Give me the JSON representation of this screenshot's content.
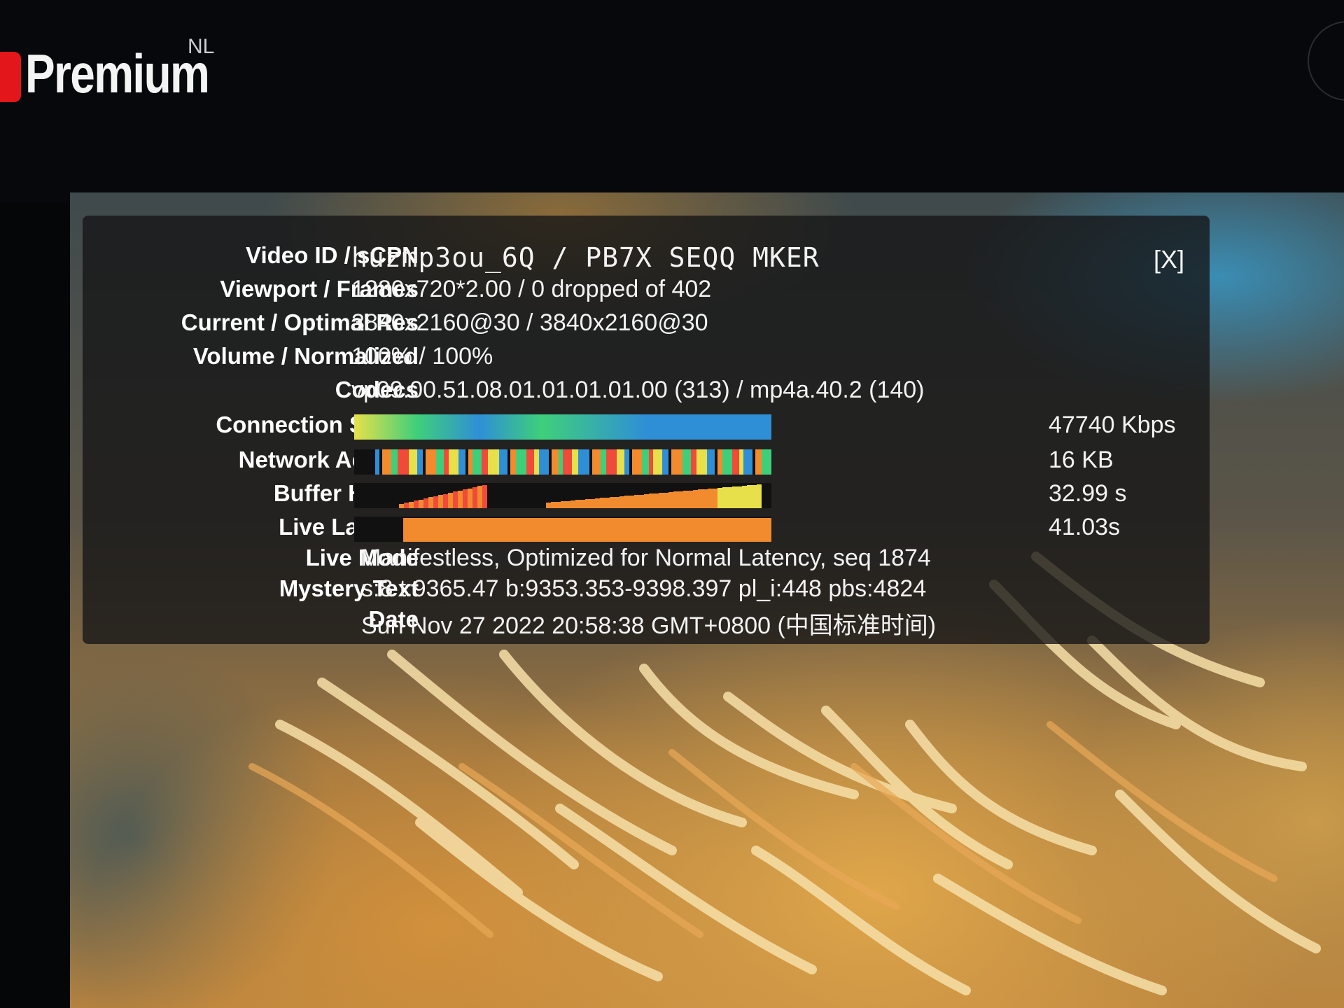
{
  "brand": {
    "word": "Premium",
    "region": "NL"
  },
  "stats": {
    "close_label": "[X]",
    "rows": [
      {
        "label": "Video ID / sCPN",
        "value": "huzmp3ou_6Q / PB7X SEQQ MKER"
      },
      {
        "label": "Viewport / Frames",
        "value": "1280x720*2.00 / 0 dropped of 402"
      },
      {
        "label": "Current / Optimal Res",
        "value": "3840x2160@30 / 3840x2160@30"
      },
      {
        "label": "Volume / Normalized",
        "value": "100% / 100%"
      },
      {
        "label": "Codecs",
        "value": "vp09.00.51.08.01.01.01.01.00 (313) / mp4a.40.2 (140)"
      }
    ],
    "graphs": [
      {
        "label": "Connection Speed",
        "metric": "47740 Kbps"
      },
      {
        "label": "Network Activity",
        "metric": "16 KB"
      },
      {
        "label": "Buffer Health",
        "metric": "32.99 s"
      },
      {
        "label": "Live Latency",
        "metric": "41.03s"
      }
    ],
    "tail_rows": [
      {
        "label": "Live Mode",
        "value": "Manifestless, Optimized for Normal Latency, seq 1874"
      },
      {
        "label": "Mystery Text",
        "value": "s:8 t:9365.47 b:9353.353-9398.397 pl_i:448 pbs:4824"
      },
      {
        "label": "Date",
        "value": "Sun Nov 27 2022 20:58:38 GMT+0800 (中国标准时间)"
      }
    ]
  },
  "colors": {
    "brand_red": "#e3161b",
    "graph_blue": "#2f8fd6",
    "graph_green": "#3fcf7a",
    "graph_yellow": "#e8e04a",
    "graph_orange": "#f28a2e",
    "graph_red": "#ef4a3a"
  }
}
